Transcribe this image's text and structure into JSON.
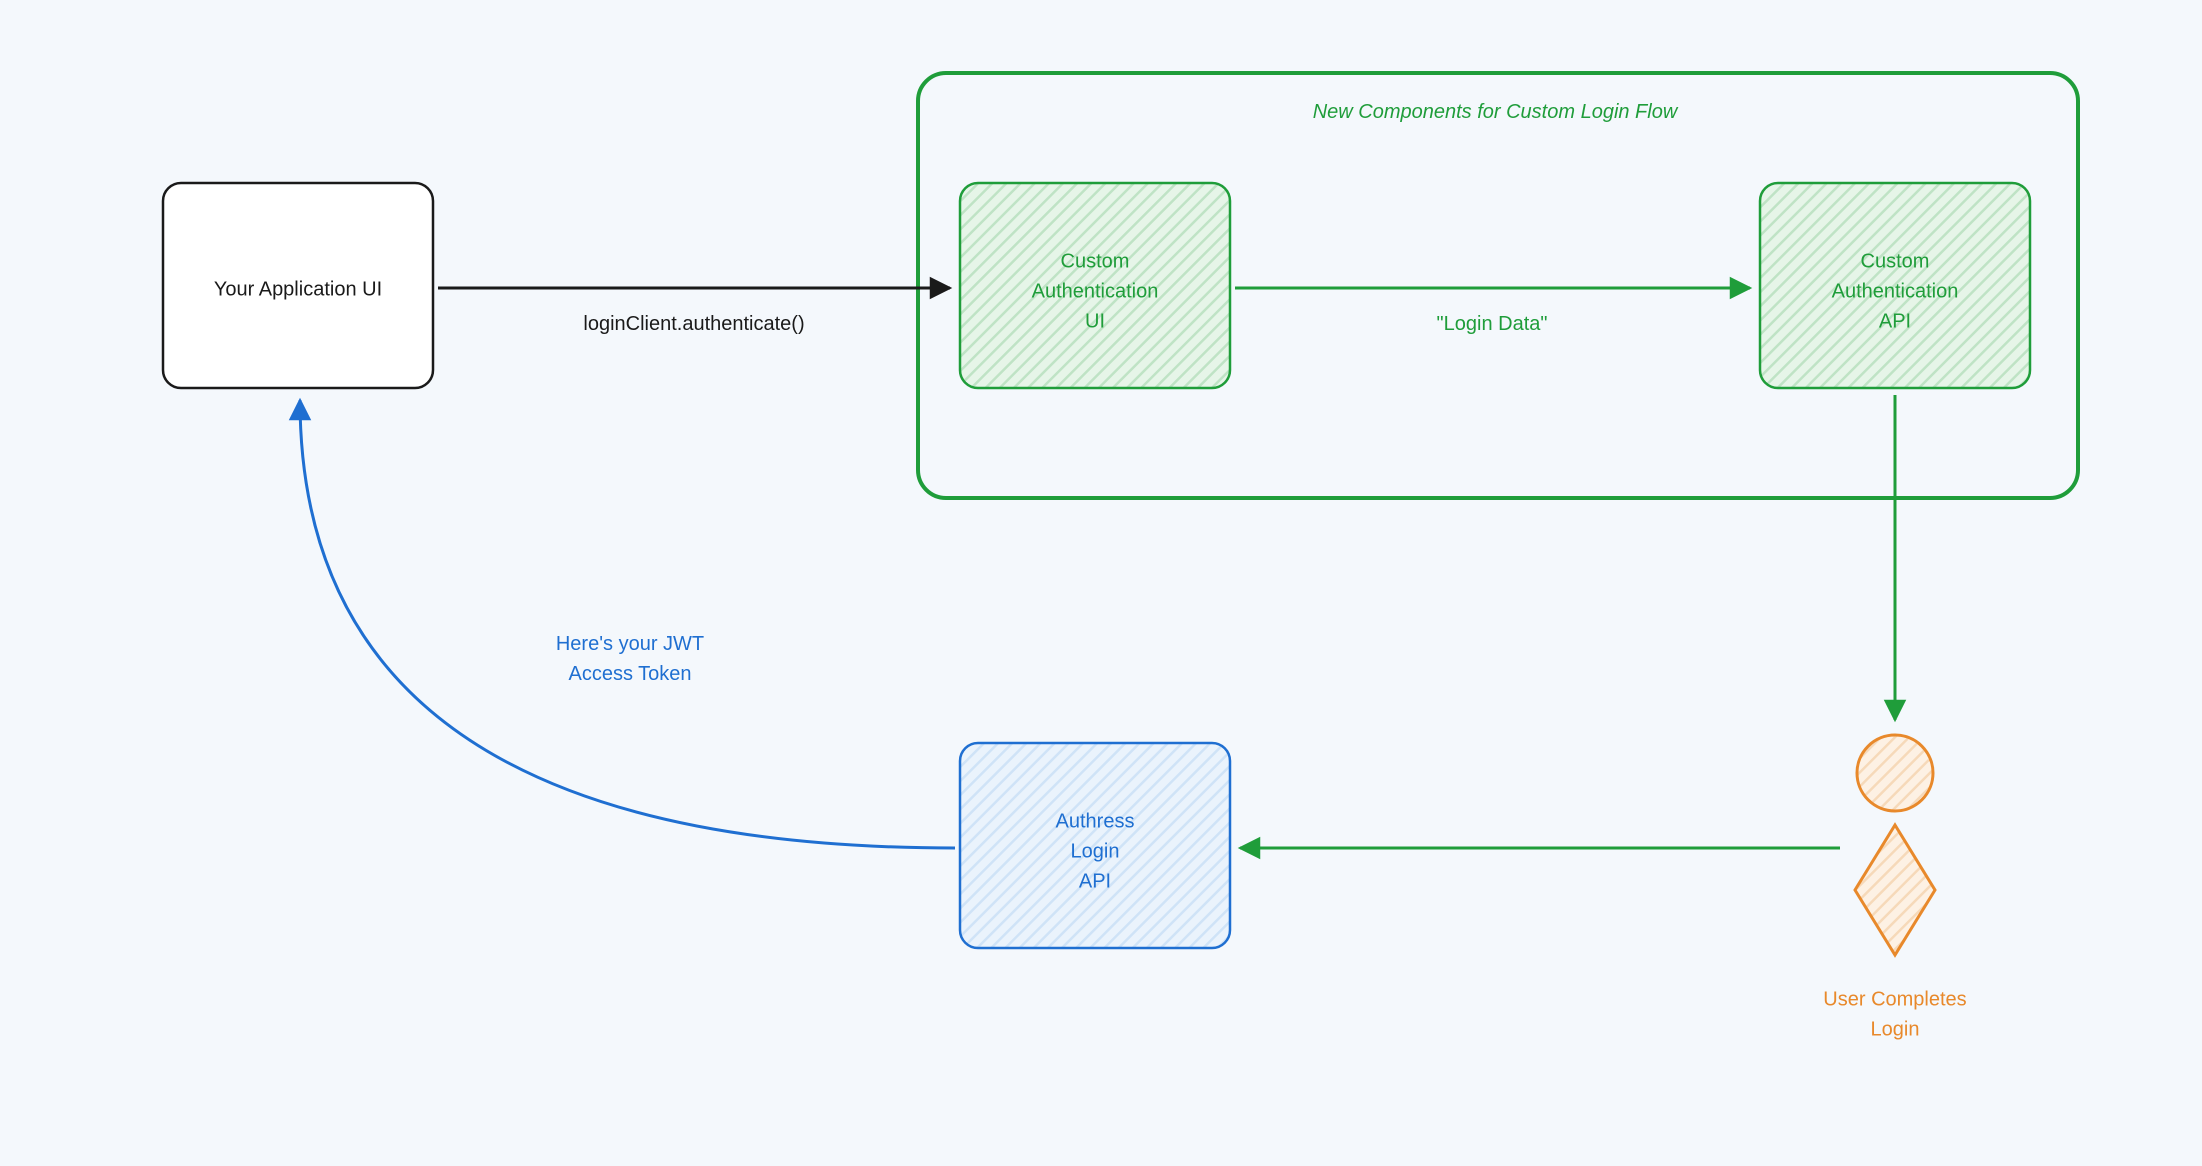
{
  "colors": {
    "bg": "#f4f8fc",
    "black": "#1a1a1a",
    "green": "#1f9d3a",
    "greenFill": "#e6f5e8",
    "blue": "#1f6fd1",
    "blueFill": "#eaf3fc",
    "orange": "#e8892b"
  },
  "nodes": {
    "appUI": {
      "label1": "Your Application UI"
    },
    "customAuthUI": {
      "label1": "Custom",
      "label2": "Authentication",
      "label3": "UI"
    },
    "customAuthAPI": {
      "label1": "Custom",
      "label2": "Authentication",
      "label3": "API"
    },
    "authressAPI": {
      "label1": "Authress",
      "label2": "Login",
      "label3": "API"
    },
    "user": {
      "label1": "User Completes",
      "label2": "Login"
    }
  },
  "group": {
    "title": "New Components for Custom Login Flow"
  },
  "edges": {
    "authenticate": "loginClient.authenticate()",
    "loginData": "\"Login Data\"",
    "jwt1": "Here's your JWT",
    "jwt2": "Access Token"
  }
}
